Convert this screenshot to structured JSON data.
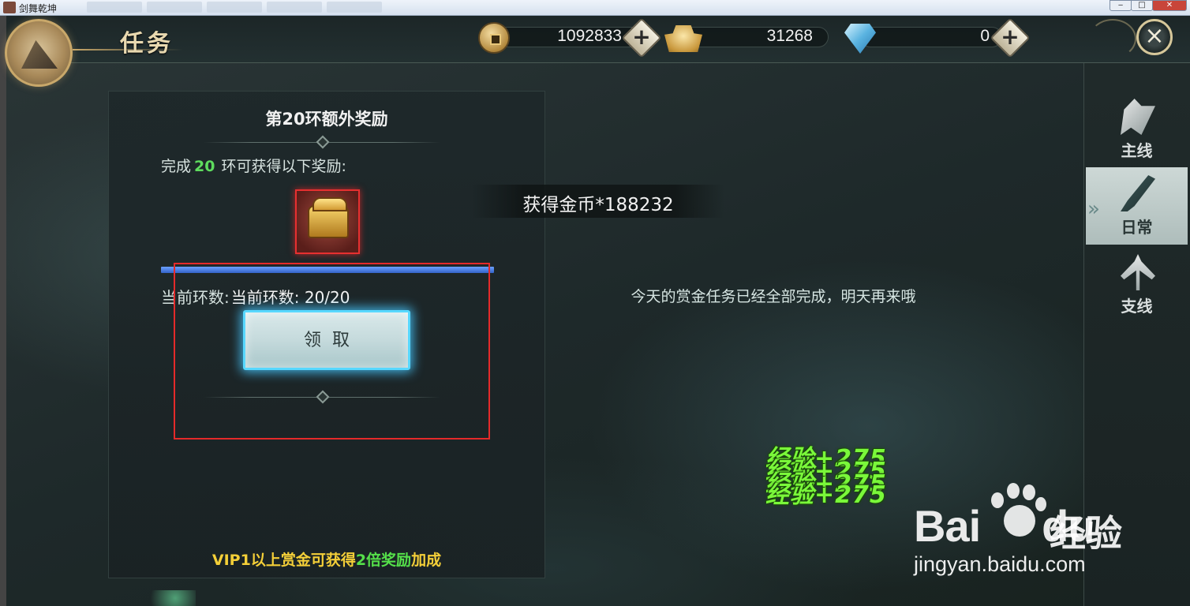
{
  "window": {
    "title": "剑舞乾坤"
  },
  "header": {
    "title": "任务",
    "currencies": [
      {
        "name": "coin",
        "icon": "copper-coin-icon",
        "value": "1092833"
      },
      {
        "name": "ingot",
        "icon": "gold-ingot-icon",
        "value": "31268"
      },
      {
        "name": "diamond",
        "icon": "diamond-icon",
        "value": "0"
      }
    ],
    "plus_glyph": "+",
    "close_glyph": "×"
  },
  "side_tabs": [
    {
      "label": "主线",
      "icon": "main-quest-icon",
      "active": false
    },
    {
      "label": "日常",
      "icon": "daily-quest-icon",
      "active": true
    },
    {
      "label": "支线",
      "icon": "side-quest-icon",
      "active": false
    }
  ],
  "reward_panel": {
    "title": "第20环额外奖励",
    "requirement_prefix": "完成",
    "requirement_count": "20",
    "requirement_suffix": "环可获得以下奖励:",
    "reward_icon": "treasure-chest-icon",
    "progress_fraction": 1.0,
    "round_label": "当前环数:",
    "round_value": "当前环数: 20/20",
    "claim_label": "领取",
    "vip_note_prefix": "VIP1以上赏金可获得",
    "vip_note_mult": "2倍奖励",
    "vip_note_suffix": "加成"
  },
  "toast": {
    "text": "获得金币*188232"
  },
  "main": {
    "done_message": "今天的赏金任务已经全部完成，明天再来哦"
  },
  "exp_popups": [
    "经验+275",
    "经验+275",
    "经验+275",
    "经验+275"
  ],
  "watermark": {
    "brand": "Bai",
    "brand_du": "du",
    "brand_cn": "经验",
    "url": "jingyan.baidu.com"
  },
  "colors": {
    "highlight_box": "#e42a2a",
    "requirement_number": "#5edc5e",
    "vip_text": "#f4cf38",
    "vip_multiplier": "#55e04a",
    "progress": "#3f74dd",
    "claim_glow": "#58d8ff",
    "exp_text": "#7af83a"
  }
}
